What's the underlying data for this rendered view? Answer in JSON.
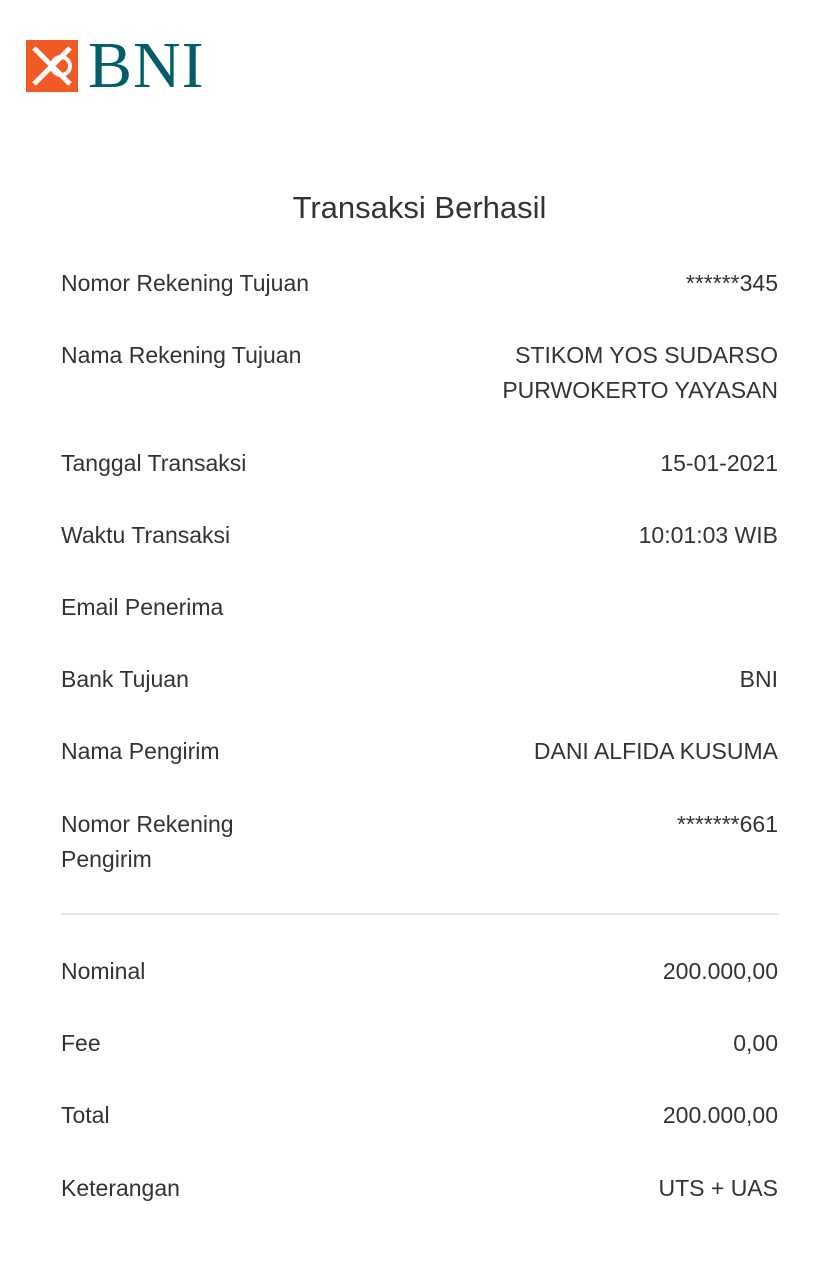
{
  "brand": {
    "logo_text": "BNI",
    "colors": {
      "mark": "#f15a24",
      "text": "#005e6a"
    }
  },
  "title": "Transaksi Berhasil",
  "details": [
    {
      "label": "Nomor Rekening Tujuan",
      "value": "******345"
    },
    {
      "label": "Nama Rekening Tujuan",
      "value": "STIKOM YOS SUDARSO PURWOKERTO YAYASAN"
    },
    {
      "label": "Tanggal Transaksi",
      "value": "15-01-2021"
    },
    {
      "label": "Waktu Transaksi",
      "value": "10:01:03 WIB"
    },
    {
      "label": "Email Penerima",
      "value": ""
    },
    {
      "label": "Bank Tujuan",
      "value": "BNI"
    },
    {
      "label": "Nama Pengirim",
      "value": "DANI ALFIDA KUSUMA"
    },
    {
      "label": "Nomor Rekening Pengirim",
      "value": "*******661"
    }
  ],
  "amounts": [
    {
      "label": "Nominal",
      "value": "200.000,00"
    },
    {
      "label": "Fee",
      "value": "0,00"
    },
    {
      "label": "Total",
      "value": "200.000,00"
    },
    {
      "label": "Keterangan",
      "value": "UTS + UAS"
    }
  ]
}
